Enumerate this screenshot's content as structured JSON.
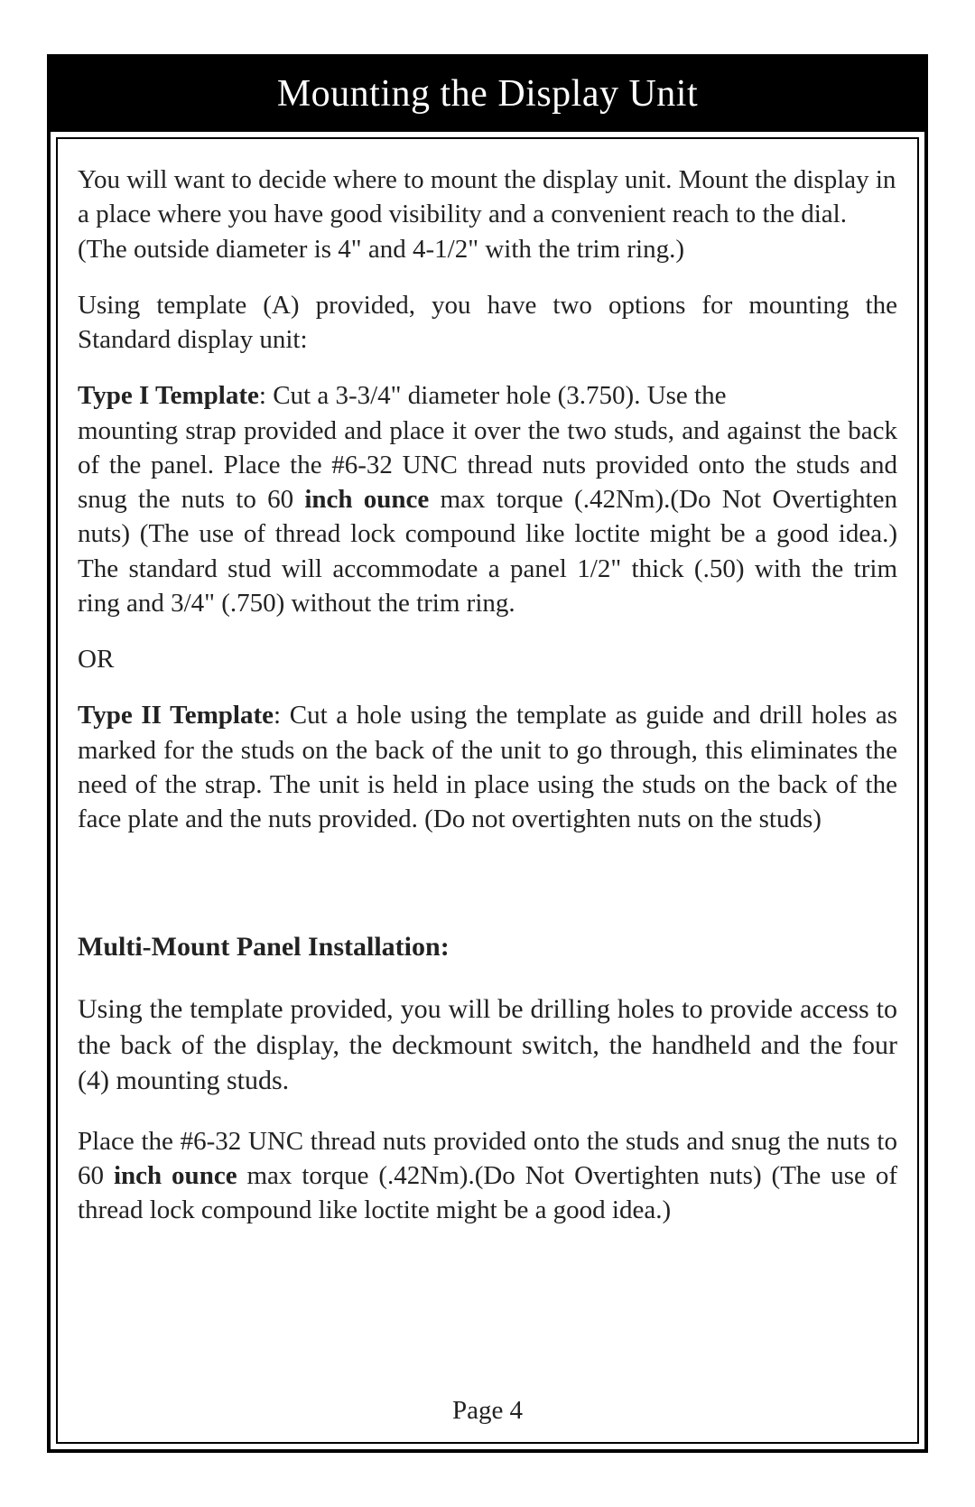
{
  "title": "Mounting the Display Unit",
  "p1": "You will want to decide where to mount the display unit.  Mount the display in a place where you have good visibility and a convenient reach to the dial. (The outside diameter is 4\" and 4-1/2\" with the trim ring.)",
  "p2": "Using template (A) provided, you have two options for mounting the Standard display unit:",
  "type1_label": "Type I Template",
  "type1_line1": ": Cut a 3-3/4\" diameter hole (3.750). Use the",
  "type1_rest_a": "mounting strap provided and place it over the two studs, and against the back of the panel. Place the #6-32 UNC thread nuts provided onto the studs and snug the nuts to 60 ",
  "type1_bold_unit": "inch ounce",
  "type1_rest_b": " max torque (.42Nm).(Do Not Overtighten nuts) (The use of thread lock compound like loctite might be a good idea.) The standard stud will accommodate a panel 1/2\" thick (.50) with the trim ring and 3/4\" (.750) without the trim ring.",
  "or_text": "OR",
  "type2_label": "Type II Template",
  "type2_text": ": Cut a hole using the template as guide and drill holes as marked for the studs on the back of the unit to go through, this eliminates the need of the strap. The unit is held in place using the studs on the back of the face plate and the nuts provided. (Do not overtighten nuts on the studs)",
  "multi_heading": "Multi-Mount Panel Installation:",
  "multi_p1": "Using the template provided, you will be drilling holes to provide access to the back of the display, the deckmount switch, the handheld and the four (4) mounting studs.",
  "multi_p2_a": "Place the #6-32 UNC thread nuts provided onto the studs and snug the nuts to 60 ",
  "multi_p2_bold": "inch ounce",
  "multi_p2_b": " max torque (.42Nm).(Do Not Overtighten nuts) (The use of thread lock compound like loctite might be a good idea.)",
  "page_number": "Page 4"
}
